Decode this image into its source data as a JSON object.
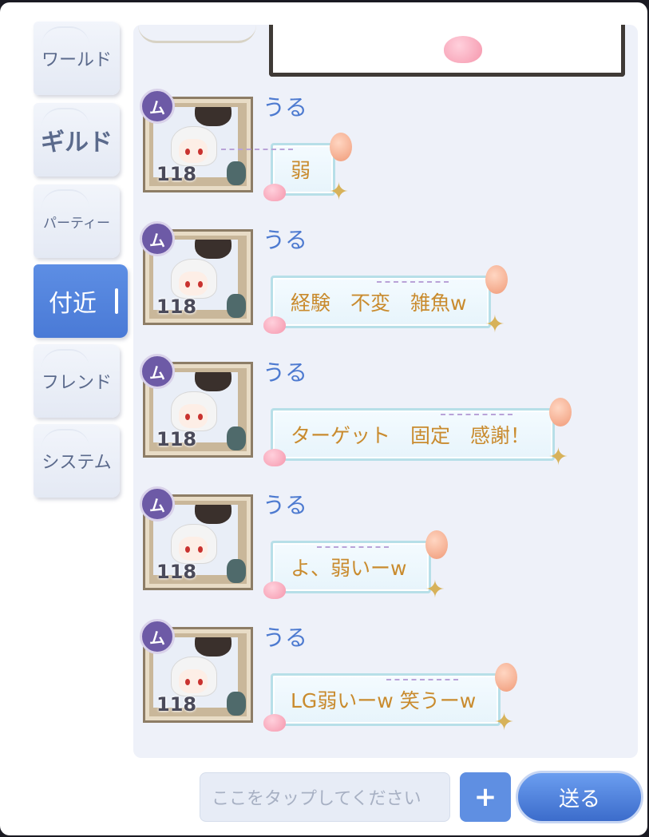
{
  "tabs": [
    {
      "label": "ワールド",
      "active": false
    },
    {
      "label": "ギルド",
      "active": false
    },
    {
      "label": "パーティー",
      "active": false
    },
    {
      "label": "付近",
      "active": true
    },
    {
      "label": "フレンド",
      "active": false
    },
    {
      "label": "システム",
      "active": false
    }
  ],
  "messages": [
    {
      "name": "うる",
      "level": "118",
      "text": "弱"
    },
    {
      "name": "うる",
      "level": "118",
      "text": "経験　不変　雑魚w"
    },
    {
      "name": "うる",
      "level": "118",
      "text": "ターゲット　固定　感謝！"
    },
    {
      "name": "うる",
      "level": "118",
      "text": "よ、弱いーw"
    },
    {
      "name": "うる",
      "level": "118",
      "text": "LG弱いーw 笑うーw"
    }
  ],
  "input": {
    "placeholder": "ここをタップしてください"
  },
  "buttons": {
    "plus": "+",
    "send": "送る"
  },
  "colors": {
    "accent": "#4a7ad6",
    "name": "#4d7ad0",
    "bubble_text": "#c98b2e"
  }
}
